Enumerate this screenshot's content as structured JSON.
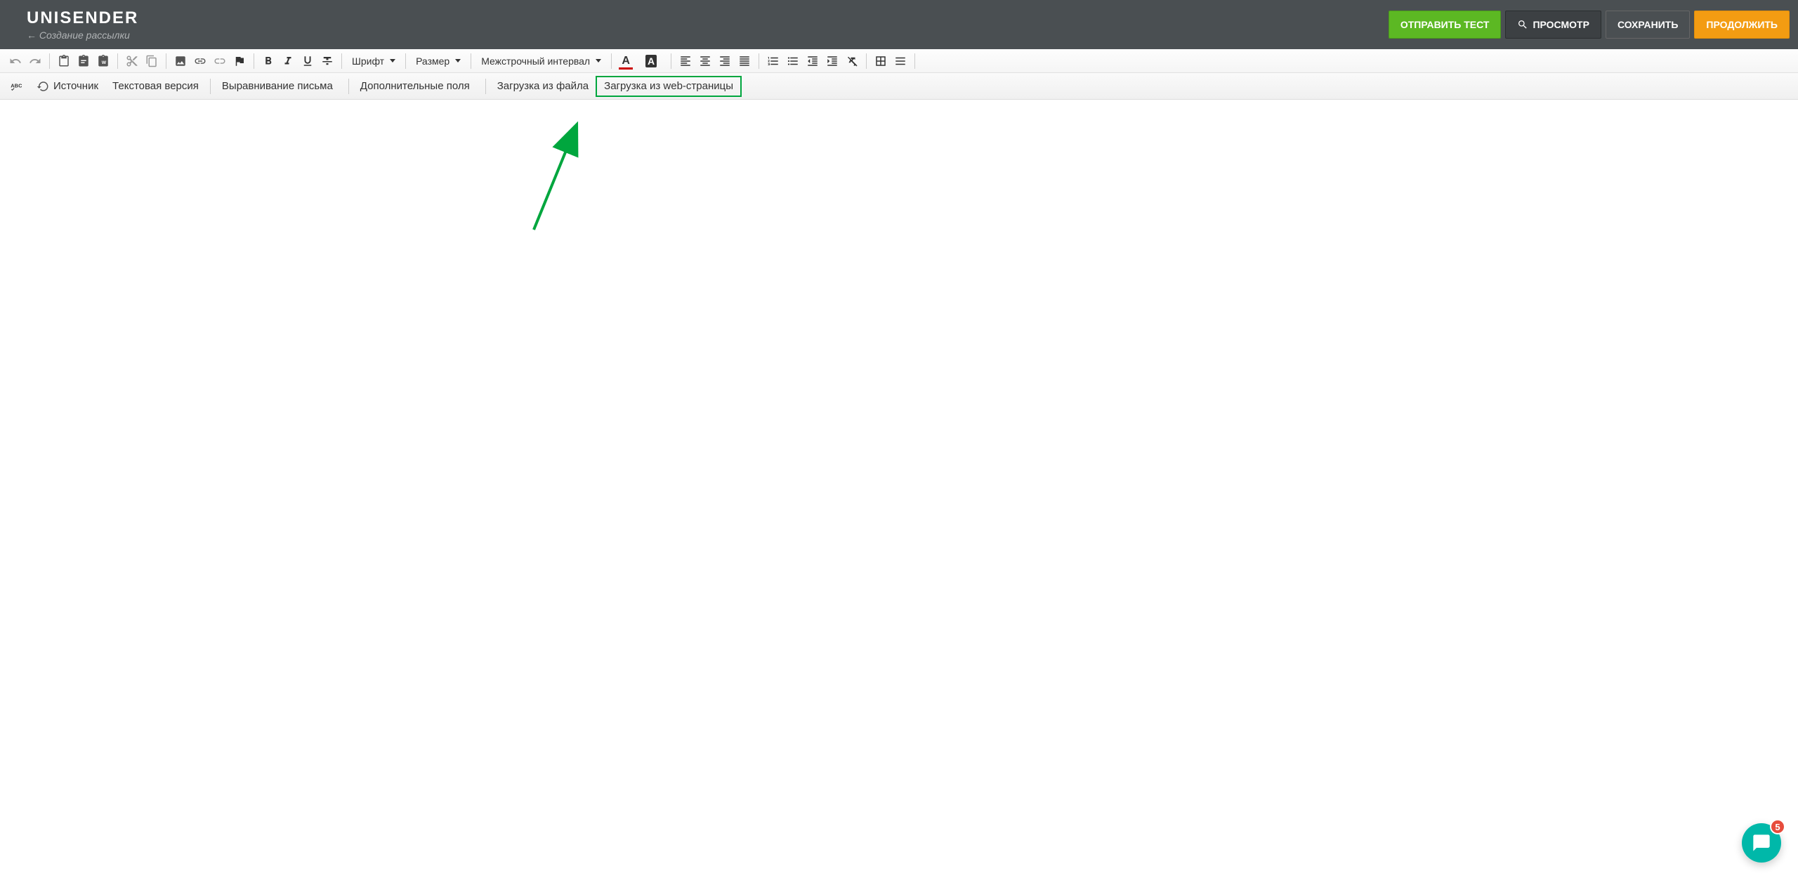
{
  "header": {
    "logo": "UNISENDER",
    "breadcrumb": "← Создание рассылки",
    "buttons": {
      "send_test": "ОТПРАВИТЬ ТЕСТ",
      "preview": "ПРОСМОТР",
      "save": "СОХРАНИТЬ",
      "continue": "ПРОДОЛЖИТЬ"
    }
  },
  "toolbar1": {
    "font_label": "Шрифт",
    "size_label": "Размер",
    "line_height_label": "Межстрочный интервал"
  },
  "toolbar2": {
    "source": "Источник",
    "text_version": "Текстовая версия",
    "letter_align": "Выравнивание письма",
    "extra_fields": "Дополнительные поля",
    "load_from_file": "Загрузка из файла",
    "load_from_web": "Загрузка из web-страницы"
  },
  "chat": {
    "badge": "5"
  }
}
